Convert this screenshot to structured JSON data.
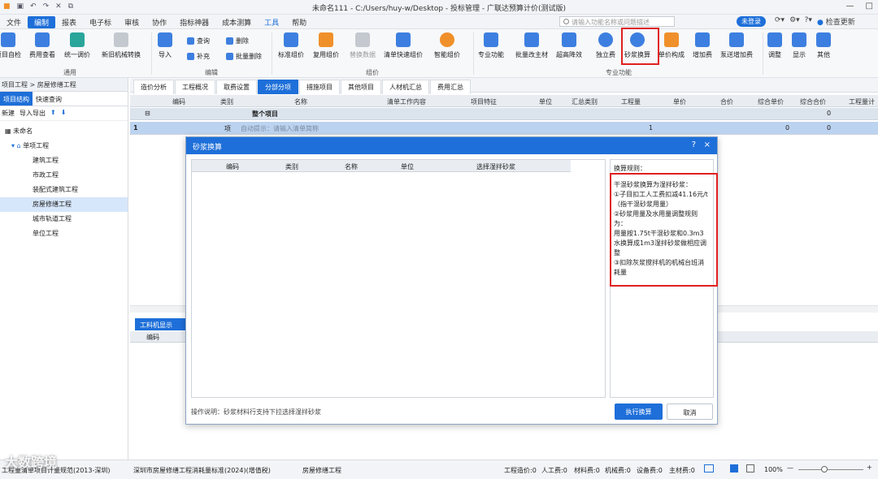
{
  "window": {
    "title": "未命名111 - C:/Users/huy-w/Desktop - 投标管理 - 广联达预算计价(测试版)",
    "controls": [
      "—",
      "□",
      "×"
    ]
  },
  "menu": {
    "items": [
      "文件",
      "编制",
      "报表",
      "电子标",
      "审核",
      "协作",
      "指标神器",
      "成本测算",
      "工具",
      "帮助"
    ],
    "active": "编制",
    "search_placeholder": "请输入功能名称或问题描述",
    "login": "未登录",
    "update": "检查更新"
  },
  "ribbon": {
    "general": {
      "items": [
        "项目自检",
        "费用查看",
        "统一调价",
        "新旧机械转换"
      ],
      "group": "通用"
    },
    "edit": {
      "import": "导入",
      "query": "查询",
      "supplement": "补充",
      "delete": "删除",
      "batch_delete": "批量删除",
      "group": "编辑"
    },
    "compose": {
      "items": [
        "标准组价",
        "复用组价",
        "替换数据",
        "清单快速组价",
        "智能组价"
      ],
      "group": "组价"
    },
    "special": {
      "items": [
        "专业功能",
        "批量改主材",
        "超高降效",
        "独立费",
        "砂浆换算",
        "单价构成",
        "增加费",
        "泵送增加费"
      ],
      "group": "专业功能"
    },
    "misc": {
      "items": [
        "调整",
        "显示",
        "其他"
      ]
    }
  },
  "left_panel": {
    "breadcrumb": "项目工程 > 房屋修缮工程",
    "tabs": [
      "项目结构",
      "快速查询"
    ],
    "tools": [
      "新建",
      "导入导出"
    ],
    "tree": [
      {
        "label": "未命名",
        "level": 0
      },
      {
        "label": "单项工程",
        "level": 1
      },
      {
        "label": "建筑工程",
        "level": 2
      },
      {
        "label": "市政工程",
        "level": 2
      },
      {
        "label": "装配式建筑工程",
        "level": 2
      },
      {
        "label": "房屋修缮工程",
        "level": 2,
        "selected": true
      },
      {
        "label": "城市轨道工程",
        "level": 2
      },
      {
        "label": "单位工程",
        "level": 2
      }
    ]
  },
  "main_tabs": {
    "items": [
      "造价分析",
      "工程概况",
      "取费设置",
      "分部分项",
      "措施项目",
      "其他项目",
      "人材机汇总",
      "费用汇总"
    ],
    "active": "分部分项"
  },
  "grid": {
    "columns": [
      "编码",
      "类别",
      "名称",
      "清单工作内容",
      "项目特征",
      "单位",
      "汇总类别",
      "工程量",
      "单价",
      "合价",
      "综合单价",
      "综合合价",
      "工程量计"
    ],
    "row1": {
      "name": "整个项目",
      "total": "0"
    },
    "row2": {
      "index": "1",
      "type": "项",
      "hint": "自动提示：请输入清单简称",
      "qty": "1",
      "unit_price": "0",
      "total": "0"
    }
  },
  "lower": {
    "tab": "工料机显示",
    "col": "编码"
  },
  "dialog": {
    "title": "砂浆换算",
    "help": "?",
    "close": "×",
    "columns": [
      "编码",
      "类别",
      "名称",
      "单位",
      "选择湿拌砂浆"
    ],
    "rules_title": "换算规则：",
    "rules_text": "干混砂浆换算为湿拌砂浆：\n①子目扣工人工费扣减41.16元/t（指干混砂浆用量）\n②砂浆用量及水用量调整规则为：\n用量按1.75t干混砂浆和0.3m3水换算成1m3湿拌砂浆做相应调整\n③扣除灰浆搅拌机的机械台班消耗量",
    "footer_note": "操作说明：砂浆材料行支持下拉选择湿拌砂浆",
    "execute": "执行换算",
    "cancel": "取消"
  },
  "status": {
    "left": "工程量清单项目计量规范(2013-深圳)",
    "standard": "深圳市房屋修缮工程消耗量标准(2024)(增值税)",
    "project": "房屋修缮工程",
    "total": "工程造价:0",
    "labor": "人工费:0",
    "material": "材料费:0",
    "machine": "机械费:0",
    "equipment": "设备费:0",
    "main_material": "主材费:0",
    "zoom": "100%"
  },
  "watermark": "大数跨境"
}
